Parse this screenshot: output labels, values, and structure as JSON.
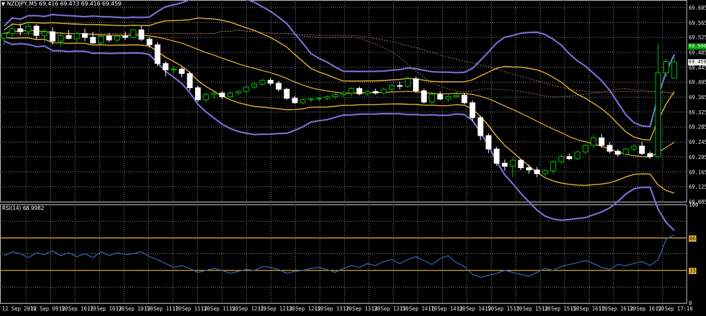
{
  "chart_header": {
    "symbol": "NZDJPY,M5",
    "ohlc": "69.416 69.473 69.416 69.459",
    "menu_icon": "triangle-down-icon"
  },
  "rsi_header": {
    "title": "RSI(14) 68.9982"
  },
  "colors": {
    "background": "#000000",
    "grid": "#8a8a8a",
    "bull_candle": "#00c000",
    "bear_candle": "#ffffff",
    "bollinger_outer": "#7b6fd6",
    "bollinger_inner": "#e8b73a",
    "cloud": "#a07060",
    "rsi_line": "#3e66b8",
    "rsi_levels": "#e8b73a",
    "bid_tag": "#00a000"
  },
  "price_axis": {
    "labels": [
      "69.605",
      "69.565",
      "69.525",
      "69.485",
      "69.445",
      "69.405",
      "69.365",
      "69.325",
      "69.285",
      "69.245",
      "69.205",
      "69.165",
      "69.125",
      "69.085"
    ],
    "bid_tag": "69.506",
    "current_tag": "69.459"
  },
  "rsi_axis": {
    "labels": [
      "100",
      "66",
      "33",
      "0"
    ]
  },
  "time_axis": {
    "labels": [
      "12 Sep 2019",
      "12 Sep 09:50",
      "12 Sep 10:10",
      "12 Sep 10:30",
      "12 Sep 10:50",
      "12 Sep 11:10",
      "12 Sep 11:30",
      "12 Sep 11:50",
      "12 Sep 12:10",
      "12 Sep 12:30",
      "12 Sep 12:50",
      "12 Sep 13:10",
      "12 Sep 13:30",
      "12 Sep 13:50",
      "12 Sep 14:10",
      "12 Sep 14:30",
      "12 Sep 14:50",
      "12 Sep 15:10",
      "12 Sep 15:30",
      "12 Sep 15:50",
      "12 Sep 16:10",
      "12 Sep 16:30",
      "12 Sep 16:50",
      "12 Sep 17:10"
    ]
  },
  "chart_data": {
    "type": "candlestick",
    "price_range": [
      69.085,
      69.625
    ],
    "candles": [
      [
        69.523,
        69.541,
        69.505,
        69.535
      ],
      [
        69.535,
        69.558,
        69.52,
        69.548
      ],
      [
        69.548,
        69.562,
        69.53,
        69.54
      ],
      [
        69.54,
        69.565,
        69.528,
        69.555
      ],
      [
        69.555,
        69.56,
        69.52,
        69.53
      ],
      [
        69.53,
        69.548,
        69.512,
        69.54
      ],
      [
        69.54,
        69.552,
        69.505,
        69.515
      ],
      [
        69.515,
        69.536,
        69.5,
        69.53
      ],
      [
        69.53,
        69.545,
        69.52,
        69.522
      ],
      [
        69.522,
        69.54,
        69.512,
        69.535
      ],
      [
        69.535,
        69.548,
        69.515,
        69.525
      ],
      [
        69.525,
        69.54,
        69.508,
        69.51
      ],
      [
        69.51,
        69.53,
        69.505,
        69.528
      ],
      [
        69.528,
        69.536,
        69.512,
        69.518
      ],
      [
        69.518,
        69.532,
        69.51,
        69.528
      ],
      [
        69.528,
        69.54,
        69.518,
        69.525
      ],
      [
        69.525,
        69.548,
        69.522,
        69.545
      ],
      [
        69.545,
        69.555,
        69.515,
        69.52
      ],
      [
        69.52,
        69.526,
        69.498,
        69.505
      ],
      [
        69.505,
        69.512,
        69.448,
        69.455
      ],
      [
        69.455,
        69.462,
        69.42,
        69.438
      ],
      [
        69.438,
        69.448,
        69.428,
        69.44
      ],
      [
        69.44,
        69.446,
        69.418,
        69.428
      ],
      [
        69.428,
        69.434,
        69.382,
        69.39
      ],
      [
        69.39,
        69.396,
        69.352,
        69.358
      ],
      [
        69.358,
        69.378,
        69.352,
        69.372
      ],
      [
        69.372,
        69.38,
        69.36,
        69.376
      ],
      [
        69.376,
        69.382,
        69.36,
        69.366
      ],
      [
        69.366,
        69.38,
        69.362,
        69.376
      ],
      [
        69.376,
        69.384,
        69.37,
        69.38
      ],
      [
        69.38,
        69.396,
        69.374,
        69.392
      ],
      [
        69.392,
        69.405,
        69.386,
        69.4
      ],
      [
        69.4,
        69.414,
        69.396,
        69.41
      ],
      [
        69.41,
        69.416,
        69.396,
        69.402
      ],
      [
        69.402,
        69.408,
        69.38,
        69.386
      ],
      [
        69.386,
        69.39,
        69.358,
        69.362
      ],
      [
        69.362,
        69.368,
        69.348,
        69.35
      ],
      [
        69.35,
        69.362,
        69.346,
        69.358
      ],
      [
        69.358,
        69.364,
        69.352,
        69.36
      ],
      [
        69.36,
        69.366,
        69.354,
        69.362
      ],
      [
        69.362,
        69.37,
        69.356,
        69.366
      ],
      [
        69.366,
        69.376,
        69.36,
        69.372
      ],
      [
        69.372,
        69.382,
        69.366,
        69.376
      ],
      [
        69.376,
        69.392,
        69.368,
        69.388
      ],
      [
        69.388,
        69.394,
        69.37,
        69.374
      ],
      [
        69.374,
        69.384,
        69.368,
        69.38
      ],
      [
        69.38,
        69.388,
        69.372,
        69.376
      ],
      [
        69.376,
        69.39,
        69.372,
        69.386
      ],
      [
        69.386,
        69.4,
        69.38,
        69.396
      ],
      [
        69.396,
        69.406,
        69.386,
        69.394
      ],
      [
        69.394,
        69.42,
        69.39,
        69.414
      ],
      [
        69.414,
        69.42,
        69.376,
        69.382
      ],
      [
        69.382,
        69.388,
        69.348,
        69.352
      ],
      [
        69.352,
        69.378,
        69.346,
        69.372
      ],
      [
        69.372,
        69.38,
        69.356,
        69.36
      ],
      [
        69.36,
        69.372,
        69.352,
        69.366
      ],
      [
        69.366,
        69.38,
        69.362,
        69.37
      ],
      [
        69.37,
        69.376,
        69.346,
        69.35
      ],
      [
        69.35,
        69.356,
        69.3,
        69.31
      ],
      [
        69.31,
        69.316,
        69.25,
        69.262
      ],
      [
        69.262,
        69.268,
        69.215,
        69.226
      ],
      [
        69.226,
        69.232,
        69.182,
        69.188
      ],
      [
        69.188,
        69.198,
        69.168,
        69.18
      ],
      [
        69.18,
        69.202,
        69.15,
        69.196
      ],
      [
        69.196,
        69.2,
        69.17,
        69.176
      ],
      [
        69.176,
        69.184,
        69.16,
        69.17
      ],
      [
        69.17,
        69.178,
        69.15,
        69.16
      ],
      [
        69.16,
        69.172,
        69.154,
        69.168
      ],
      [
        69.168,
        69.196,
        69.16,
        69.192
      ],
      [
        69.192,
        69.212,
        69.186,
        69.206
      ],
      [
        69.206,
        69.214,
        69.196,
        69.2
      ],
      [
        69.2,
        69.222,
        69.196,
        69.218
      ],
      [
        69.218,
        69.24,
        69.212,
        69.236
      ],
      [
        69.236,
        69.264,
        69.23,
        69.256
      ],
      [
        69.256,
        69.266,
        69.23,
        69.236
      ],
      [
        69.236,
        69.244,
        69.214,
        69.22
      ],
      [
        69.22,
        69.226,
        69.206,
        69.212
      ],
      [
        69.212,
        69.23,
        69.208,
        69.226
      ],
      [
        69.226,
        69.24,
        69.22,
        69.234
      ],
      [
        69.234,
        69.246,
        69.21,
        69.214
      ],
      [
        69.214,
        69.22,
        69.2,
        69.206
      ],
      [
        69.206,
        69.506,
        69.2,
        69.43
      ],
      [
        69.43,
        69.468,
        69.42,
        69.46
      ],
      [
        69.416,
        69.473,
        69.416,
        69.459
      ]
    ],
    "rsi": {
      "levels": [
        66,
        33
      ],
      "range": [
        0,
        100
      ],
      "values": [
        48,
        52,
        50,
        46,
        51,
        49,
        53,
        48,
        51,
        47,
        50,
        46,
        52,
        48,
        51,
        49,
        50,
        52,
        47,
        44,
        40,
        36,
        38,
        35,
        31,
        33,
        35,
        33,
        30,
        32,
        34,
        33,
        37,
        36,
        34,
        30,
        32,
        33,
        35,
        36,
        34,
        31,
        35,
        38,
        36,
        40,
        38,
        42,
        44,
        40,
        44,
        47,
        43,
        39,
        45,
        48,
        41,
        37,
        29,
        26,
        28,
        30,
        33,
        31,
        29,
        27,
        31,
        35,
        33,
        37,
        39,
        41,
        43,
        40,
        36,
        34,
        39,
        38,
        40,
        42,
        38,
        44,
        65,
        69
      ]
    }
  }
}
